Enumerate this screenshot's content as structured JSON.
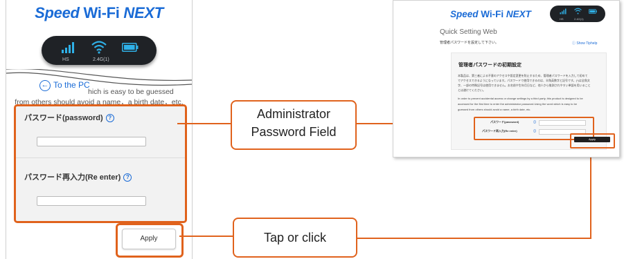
{
  "phone": {
    "brand": {
      "speed": "Speed",
      "wifi": "Wi-Fi",
      "next": "NEXT"
    },
    "status": {
      "mode": "HS",
      "band": "2.4G(1)",
      "signal_icon": "signal-bars-icon",
      "wifi_icon": "wifi-icon",
      "battery_icon": "battery-icon"
    },
    "back_link": "To the PC",
    "notice_line1": "hich is easy to be guessed",
    "notice_line2": "from others should avoid a name，a birth date，etc.",
    "password_label": "パスワード(password)",
    "reenter_label": "パスワード再入力(Re enter)",
    "help_glyph": "?",
    "apply_label": "Apply"
  },
  "callouts": {
    "admin_line1": "Administrator",
    "admin_line2": "Password Field",
    "tap": "Tap or click"
  },
  "desktop": {
    "brand": {
      "speed": "Speed",
      "wifi": "Wi-Fi",
      "next": "NEXT"
    },
    "status": {
      "mode": "HS",
      "band": "2.4G(1)"
    },
    "title": "Quick Setting Web",
    "prompt": "管理者パスワードを設定して下さい。",
    "help_link": "Show Tiphelp",
    "panel_title": "管理者パスワードの初期設定",
    "jp_line1": "本製品は、第三者による不意のアクセスや設定変更を防止するため、管理者パスワードを入力して初めて",
    "jp_line2": "でアクセスできるようになっています。パスワードで使用できるのは、半角英数字と記号です。(*)は全角文",
    "jp_line3": "字、一部の特殊記号は使用できません。お名前や生年月日など、他人から推測されやすい単語を用いること",
    "jp_line4": "とは避けてください。",
    "en_line1": "In order to prevent accidental access or change settings by a third party, this product is designed to be",
    "en_line2": "accessed for the first time to enter the administrator password.Using the word which is easy to be",
    "en_line3": "guessed from others should avoid a name, a birth date, etc.",
    "password_label": "パスワード(password)",
    "reenter_label": "パスワード再入力(Re enter)",
    "apply_label": "Apply"
  },
  "colors": {
    "accent": "#e0621c",
    "brand": "#1a6bd6",
    "status_bar": "#1f2226"
  }
}
